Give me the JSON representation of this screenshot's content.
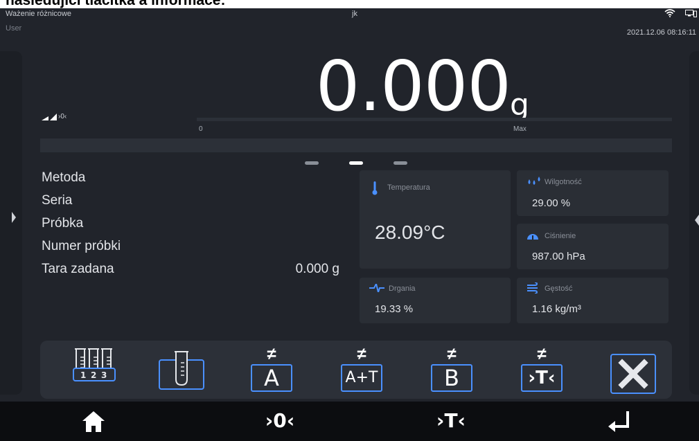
{
  "doc_heading": "následující tlačítka a informace:",
  "status": {
    "app_title": "Ważenie różnicowe",
    "user": "User",
    "operator": "jk",
    "datetime": "2021.12.06 08:16:11"
  },
  "weighing": {
    "value": "0.000",
    "unit": "g",
    "zero_symbol": "›0‹",
    "bargraph_min": "0",
    "bargraph_max": "Max",
    "bargraph_fill": 0
  },
  "params": [
    {
      "label": "Metoda",
      "value": ""
    },
    {
      "label": "Seria",
      "value": ""
    },
    {
      "label": "Próbka",
      "value": ""
    },
    {
      "label": "Numer próbki",
      "value": ""
    },
    {
      "label": "Tara zadana",
      "value": "0.000 g"
    }
  ],
  "tiles": {
    "temperature": {
      "label": "Temperatura",
      "value": "28.09°C",
      "icon": "thermometer-icon"
    },
    "humidity": {
      "label": "Wilgotność",
      "value": "29.00 %",
      "icon": "droplets-icon"
    },
    "pressure": {
      "label": "Ciśnienie",
      "value": "987.00 hPa",
      "icon": "gauge-icon"
    },
    "vibration": {
      "label": "Drgania",
      "value": "19.33 %",
      "icon": "vibration-icon"
    },
    "density": {
      "label": "Gęstość",
      "value": "1.16 kg/m³",
      "icon": "wind-icon"
    }
  },
  "actions": {
    "series_icon": "test-tubes-series-icon",
    "sample_icon": "test-tube-icon",
    "tare_a_label": "A",
    "tare_a_sign": "≠",
    "tare_at_label": "A+T",
    "tare_at_sign": "≠",
    "tare_b_label": "B",
    "tare_b_sign": "≠",
    "tare_t_label": "›T‹",
    "tare_t_sign": "≠",
    "close_icon": "close-icon"
  },
  "nav": {
    "home_icon": "home-icon",
    "zero_label": "›0‹",
    "tare_label": "›T‹",
    "enter_icon": "enter-icon"
  },
  "colors": {
    "accent": "#4a90ff",
    "background": "#21242b",
    "tile": "#2a2e35",
    "nav": "#0c0d10"
  }
}
